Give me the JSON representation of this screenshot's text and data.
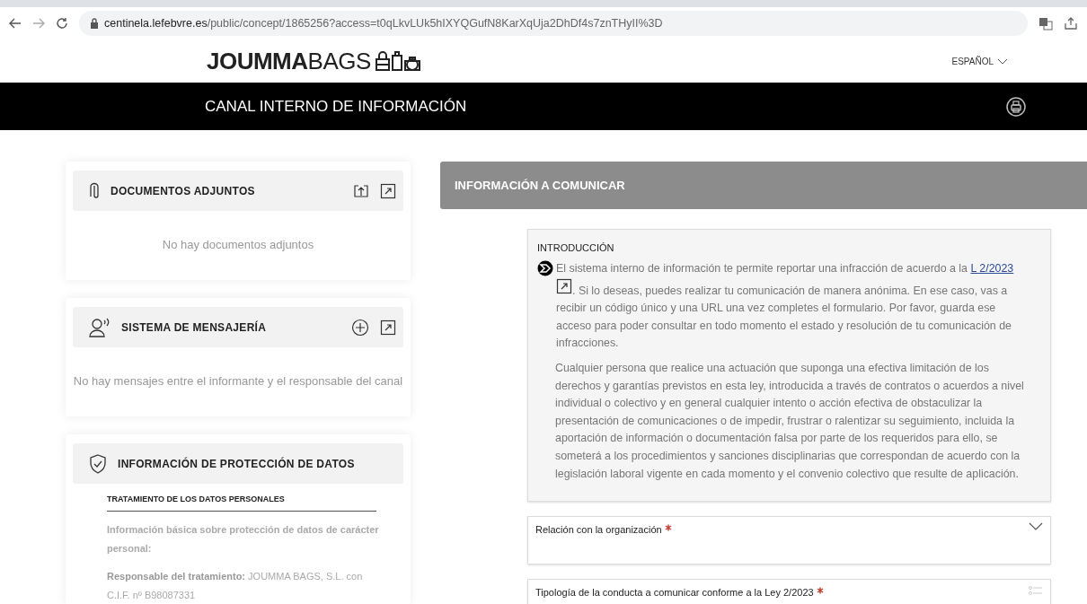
{
  "browser": {
    "url_host": "centinela.lefebvre.es",
    "url_path": "/public/concept/1865256?access=t0qLkvLUk5hIXYQGufN8KarXqUja2DhDf4s7znTHyII%3D"
  },
  "header": {
    "logo": "**JOUMMA**BAGS",
    "language": "ESPAÑOL"
  },
  "banner": {
    "title": "CANAL INTERNO DE INFORMACIÓN"
  },
  "sidebar": [
    {
      "kind": "attachments",
      "title": "DOCUMENTOS ADJUNTOS",
      "empty_text": "No hay documentos adjuntos"
    },
    {
      "kind": "messages",
      "title": "SISTEMA DE MENSAJERÍA",
      "empty_text": "No hay mensajes entre el informante y el responsable del canal"
    },
    {
      "kind": "privacy",
      "title": "INFORMACIÓN DE PROTECCIÓN DE DATOS",
      "subtitle": "TRATAMIENTO DE LOS DATOS PERSONALES",
      "paragraphs": [
        "Información básica sobre protección de datos de carácter personal:",
        "**Responsable del tratamiento:** JOUMMA BAGS, S.L. con C.I.F. nº B98087331"
      ]
    }
  ],
  "main": {
    "title": "INFORMACIÓN A COMUNICAR",
    "intro": {
      "title": "INTRODUCCIÓN",
      "lead": {
        "before": "El sistema interno de información te permite reportar una infracción de acuerdo a la",
        "link": "L 2/2023",
        "after": ". Si lo deseas, puedes realizar tu comunicación de manera anónima. En ese caso, vas a recibir un código único y una URL una vez completes el formulario. Por favor, guarda ese acceso para poder consultar en todo momento el estado y resolución de tu comunicación de infracciones."
      },
      "paragraphs": [
        "Cualquier persona que realice una actuación que suponga una efectiva limitación de los derechos y garantías previstos en esta ley, introducida a través de contratos o acuerdos a nivel individual o colectivo y en general cualquier intento o acción efectiva de obstaculizar la presentación de comunicaciones o de impedir, frustrar o ralentizar su seguimiento, incluida la aportación de información o documentación falsa por parte de los requeridos para ello, se someterá a los procedimientos y sanciones disciplinarias que correspondan de acuerdo con la legislación laboral vigente en cada momento y el convenio colectivo que resulte de aplicación."
      ]
    },
    "fields": [
      {
        "kind": "select",
        "label": "Relación con la organización",
        "required": true
      },
      {
        "kind": "list",
        "label": "Tipología de la conducta a comunicar conforme a la Ley 2/2023",
        "required": true
      }
    ]
  }
}
